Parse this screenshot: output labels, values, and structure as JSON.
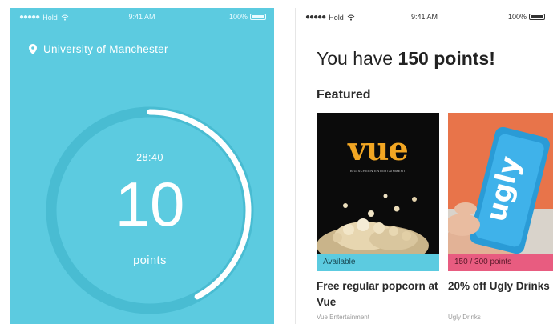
{
  "left_screen": {
    "status": {
      "carrier": "Hold",
      "time": "9:41 AM",
      "battery": "100%"
    },
    "location": "University of Manchester",
    "timer": "28:40",
    "points_value": "10",
    "points_label": "points",
    "ring_progress": 0.42,
    "colors": {
      "background": "#5ccbe0",
      "ring_track": "#49bcd2",
      "ring_fill": "#ffffff"
    }
  },
  "right_screen": {
    "status": {
      "carrier": "Hold",
      "time": "9:41 AM",
      "battery": "100%"
    },
    "headline_prefix": "You have ",
    "headline_points": "150 points!",
    "section_title": "Featured",
    "cards": [
      {
        "brand": "vue",
        "tagline": "BIG SCREEN ENTERTAINMENT",
        "tag": "Available",
        "title": "Free regular popcorn at Vue",
        "subtitle": "Vue Entertainment",
        "tag_color": "#5ccbe0"
      },
      {
        "brand": "ugly",
        "tag": "150 / 300 points",
        "title": "20% off Ugly Drinks",
        "subtitle": "Ugly Drinks",
        "tag_color": "#e85c80"
      }
    ]
  }
}
